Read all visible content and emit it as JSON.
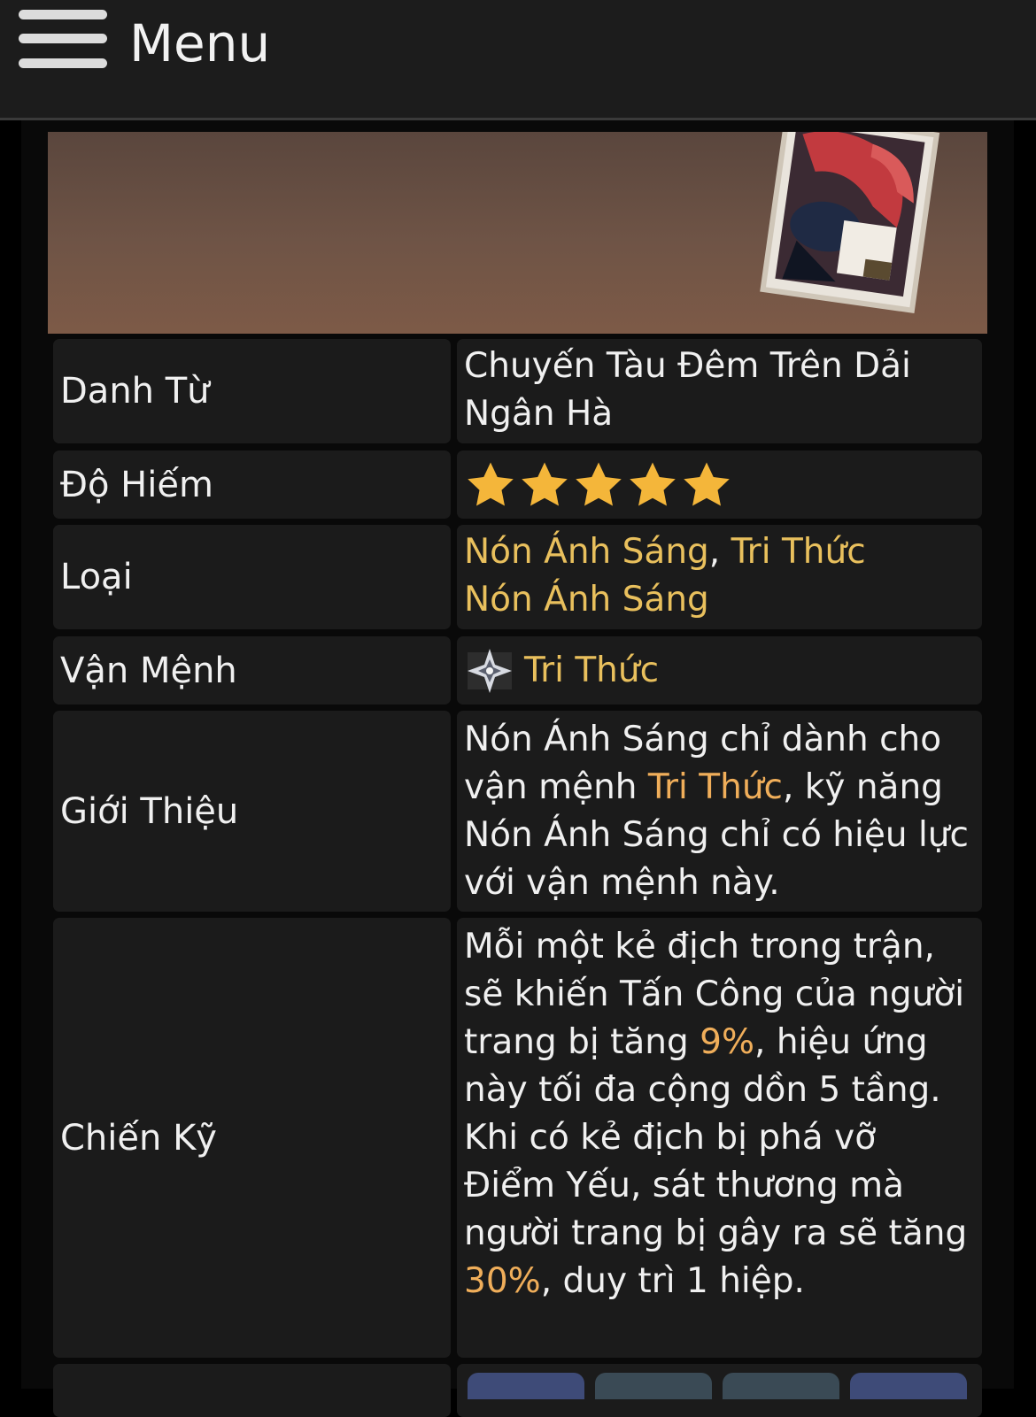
{
  "header": {
    "menu_label": "Menu"
  },
  "rows": [
    {
      "label": "Danh Từ",
      "value": "Chuyến Tàu Đêm Trên Dải Ngân Hà"
    },
    {
      "label": "Độ Hiếm",
      "stars": 5
    },
    {
      "label": "Loại",
      "value_parts": [
        "Nón Ánh Sáng",
        ", ",
        "Tri Thức",
        "Nón Ánh Sáng"
      ]
    },
    {
      "label": "Vận Mệnh",
      "value": "Tri Thức",
      "icon": "erudition-path-icon"
    },
    {
      "label": "Giới Thiệu",
      "value_parts": [
        "Nón Ánh Sáng chỉ dành cho vận mệnh ",
        "Tri Thức",
        ", kỹ năng Nón Ánh Sáng chỉ có hiệu lực với vận mệnh này."
      ]
    },
    {
      "label": "Chiến Kỹ",
      "value_parts": [
        "Mỗi một kẻ địch trong trận, sẽ khiến Tấn Công của người trang bị tăng ",
        "9%",
        ", hiệu ứng này tối đa cộng dồn 5 tầng. Khi có kẻ địch bị phá vỡ Điểm Yếu, sát thương mà người trang bị gây ra sẽ tăng ",
        "30%",
        ", duy trì 1 hiệp."
      ]
    }
  ],
  "colors": {
    "link_gold": "#e9c05d",
    "highlight_orange": "#f0ae5a",
    "star": "#f4b63a",
    "cell_bg": "#1b1b1b"
  },
  "chips": [
    {
      "color": "#3e4b78"
    },
    {
      "color": "#3a4a55"
    },
    {
      "color": "#3a4a55"
    },
    {
      "color": "#3e4b78"
    }
  ]
}
